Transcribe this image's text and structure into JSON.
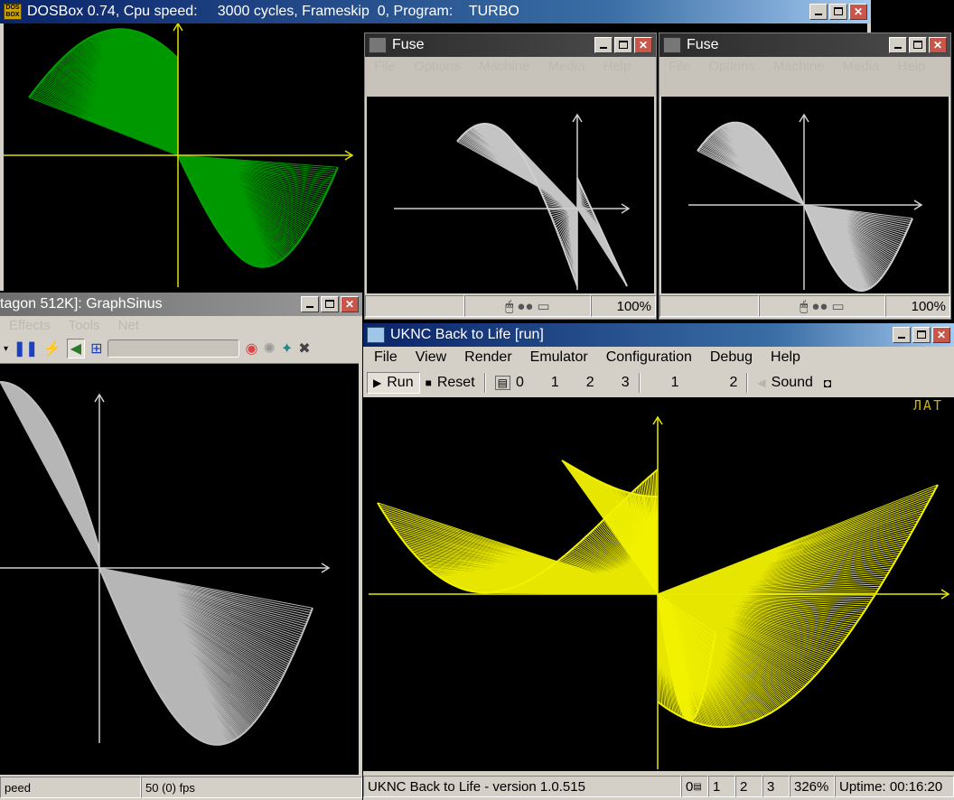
{
  "dosbox": {
    "title": "DOSBox 0.74, Cpu speed:     3000 cycles, Frameskip  0, Program:    TURBO",
    "icon": "dosbox-icon",
    "plot_color": "#00a000"
  },
  "fuse_left": {
    "title": "Fuse",
    "menu": [
      "File",
      "Options",
      "Machine",
      "Media",
      "Help"
    ],
    "zoom": "100%",
    "plot_color": "#cfcfcf"
  },
  "fuse_right": {
    "title": "Fuse",
    "menu": [
      "File",
      "Options",
      "Machine",
      "Media",
      "Help"
    ],
    "zoom": "100%",
    "plot_color": "#cfcfcf"
  },
  "unreal": {
    "title": "tagon 512K]: GraphSinus",
    "menu": [
      "Effects",
      "Tools",
      "Net"
    ],
    "status_left": "peed",
    "status_fps": "50 (0) fps",
    "plot_color": "#c0c0c0"
  },
  "uknc": {
    "title": "UKNC Back to Life [run]",
    "menu": [
      "File",
      "View",
      "Render",
      "Emulator",
      "Configuration",
      "Debug",
      "Help"
    ],
    "toolbar": {
      "run": "Run",
      "reset": "Reset",
      "drive0": "0",
      "drive1": "1",
      "drive2": "2",
      "drive3": "3",
      "hd1": "1",
      "hd2": "2",
      "sound": "Sound"
    },
    "screen_indicator": "ЛАТ",
    "status": {
      "version": "UKNC Back to Life - version 1.0.515",
      "s0": "0",
      "s1": "1",
      "s2": "2",
      "s3": "3",
      "speed": "326%",
      "uptime": "Uptime: 00:16:20"
    },
    "plot_color": "#f2f200",
    "axis_color": "#e8e800"
  },
  "colors": {
    "title_active": "#0a246a",
    "axis_dosbox": "#e0e000",
    "axis_gray": "#d0d0d0"
  }
}
